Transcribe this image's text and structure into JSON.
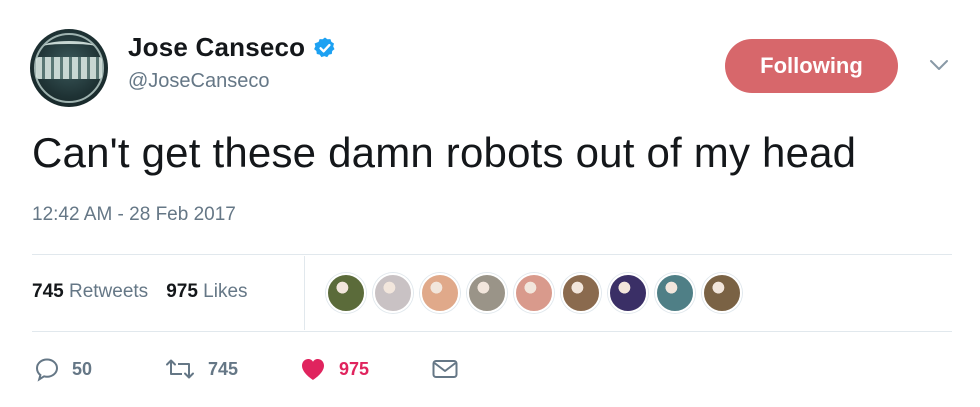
{
  "user": {
    "display_name": "Jose Canseco",
    "handle": "@JoseCanseco",
    "verified": true
  },
  "follow_button": {
    "label": "Following",
    "color": "#d7676b"
  },
  "tweet": {
    "text": "Can't get these damn robots out of my head",
    "timestamp": "12:42 AM - 28 Feb 2017"
  },
  "stats": {
    "retweets": {
      "count": "745",
      "label": "Retweets"
    },
    "likes": {
      "count": "975",
      "label": "Likes"
    }
  },
  "likers": [
    {
      "icon": "liker-avatar",
      "color": "#5b6b3a"
    },
    {
      "icon": "liker-avatar",
      "color": "#c9c2c4"
    },
    {
      "icon": "liker-avatar",
      "color": "#e0a98a"
    },
    {
      "icon": "liker-avatar",
      "color": "#9a9488"
    },
    {
      "icon": "liker-avatar",
      "color": "#d99a8c"
    },
    {
      "icon": "liker-avatar",
      "color": "#8a6a4e"
    },
    {
      "icon": "liker-avatar",
      "color": "#3a2f66"
    },
    {
      "icon": "liker-avatar",
      "color": "#4f7f86"
    },
    {
      "icon": "liker-avatar",
      "color": "#7a6244"
    }
  ],
  "actions": {
    "reply_count": "50",
    "retweet_count": "745",
    "like_count": "975"
  },
  "colors": {
    "text": "#14171a",
    "secondary": "#657786",
    "like": "#e0245e",
    "verified": "#1da1f2",
    "divider": "#e1e8ed"
  }
}
